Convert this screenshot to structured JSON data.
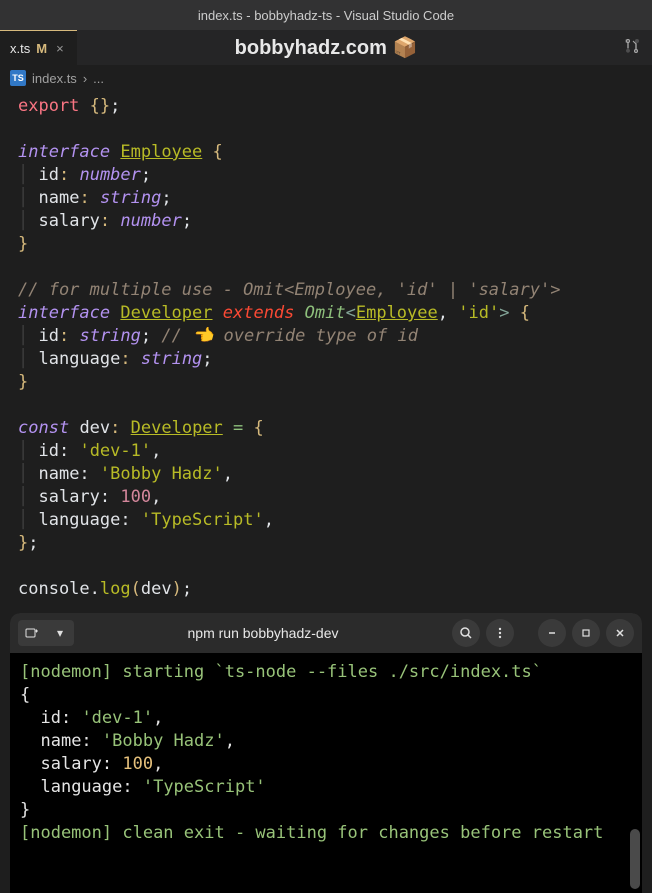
{
  "window": {
    "title": "index.ts - bobbyhadz-ts - Visual Studio Code"
  },
  "tab": {
    "name": "x.ts",
    "modified_indicator": "M",
    "close": "×"
  },
  "header": {
    "label": "bobbyhadz.com 📦"
  },
  "breadcrumb": {
    "icon_text": "TS",
    "file": "index.ts",
    "sep": "›",
    "more": "..."
  },
  "code": {
    "l1_export": "export",
    "l1_braces": "{}",
    "l1_semi": ";",
    "l3_interface": "interface",
    "l3_employee": "Employee",
    "l3_brace": "{",
    "l4_id": "id",
    "l4_colon": ":",
    "l4_number": "number",
    "l4_semi": ";",
    "l5_name": "name",
    "l5_string": "string",
    "l6_salary": "salary",
    "l6_number": "number",
    "l7_brace": "}",
    "l9_comment": "// for multiple use - Omit<Employee, 'id' | 'salary'>",
    "l10_interface": "interface",
    "l10_developer": "Developer",
    "l10_extends": "extends",
    "l10_omit": "Omit",
    "l10_employee": "Employee",
    "l10_idstr": "'id'",
    "l11_id": "id",
    "l11_string": "string",
    "l11_comment": "// 👈️ override type of id",
    "l12_language": "language",
    "l12_string": "string",
    "l13_brace": "}",
    "l15_const": "const",
    "l15_dev": "dev",
    "l15_developer": "Developer",
    "l15_eq": "=",
    "l16_id": "id:",
    "l16_val": "'dev-1'",
    "l17_name": "name:",
    "l17_val": "'Bobby Hadz'",
    "l18_salary": "salary:",
    "l18_val": "100",
    "l19_language": "language:",
    "l19_val": "'TypeScript'",
    "l20_close": "};",
    "l22_console": "console",
    "l22_log": "log",
    "l22_dev": "dev"
  },
  "terminal": {
    "title": "npm run bobbyhadz-dev",
    "line1_prefix": "[nodemon]",
    "line1_rest": " starting `ts-node --files ./src/index.ts`",
    "line2": "{",
    "line3_key": "  id: ",
    "line3_val": "'dev-1'",
    "line4_key": "  name: ",
    "line4_val": "'Bobby Hadz'",
    "line5_key": "  salary: ",
    "line5_val": "100",
    "line6_key": "  language: ",
    "line6_val": "'TypeScript'",
    "line7": "}",
    "line8_prefix": "[nodemon]",
    "line8_rest": " clean exit - waiting for changes before restart"
  }
}
